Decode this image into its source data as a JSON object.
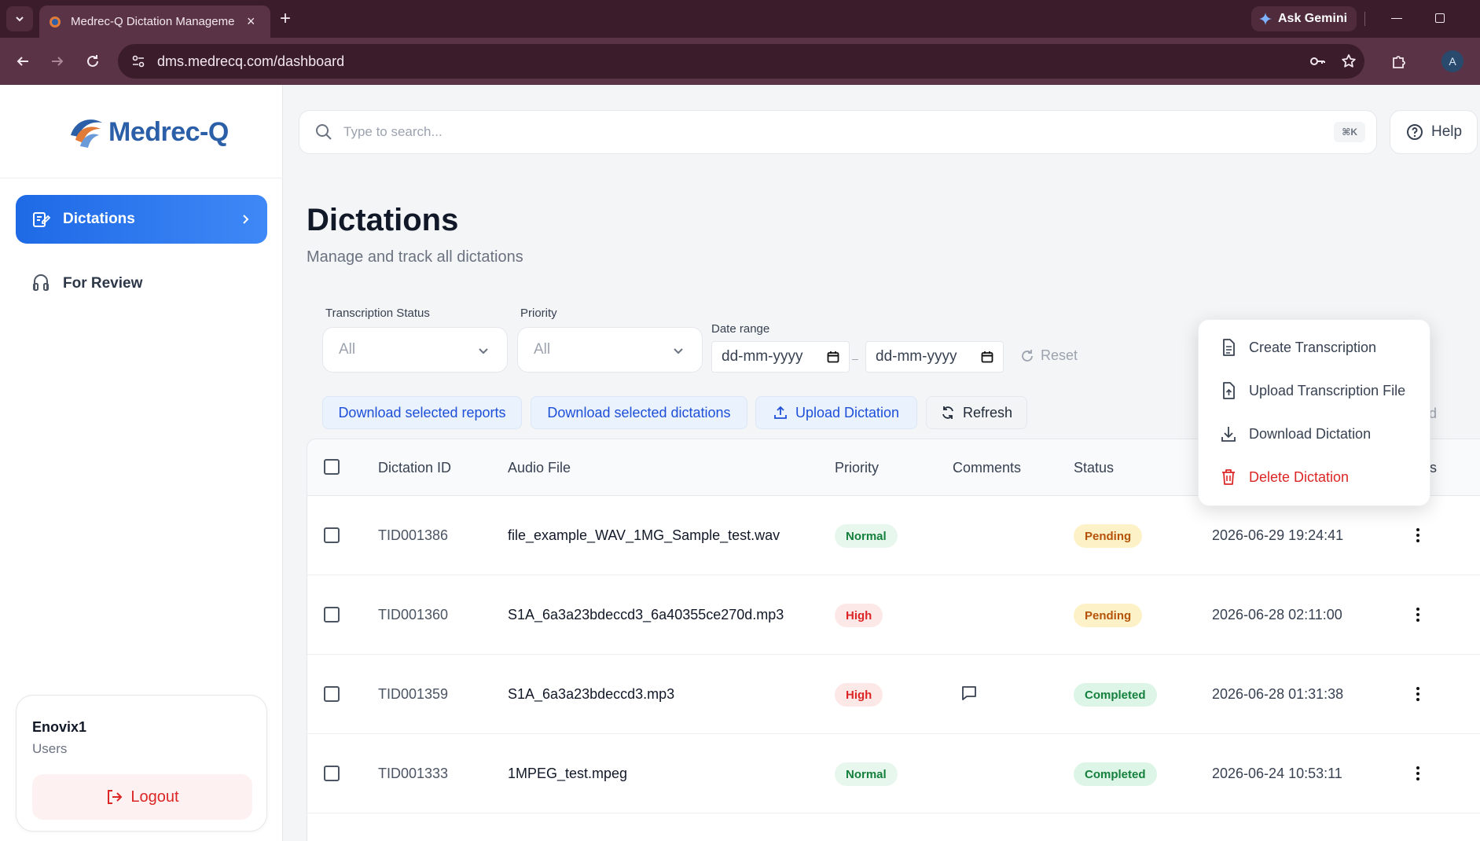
{
  "browser": {
    "tab_title": "Medrec-Q Dictation Manageme",
    "url": "dms.medrecq.com/dashboard",
    "gemini_label": "Ask Gemini",
    "profile_initial": "A"
  },
  "app": {
    "logo_text": "Medrec-Q",
    "brand_color": "#2b5fa8",
    "accent_color": "#1e6ae6"
  },
  "sidebar": {
    "items": [
      {
        "label": "Dictations",
        "icon": "edit-document-icon",
        "active": true
      },
      {
        "label": "For Review",
        "icon": "review-headset-icon",
        "active": false
      }
    ],
    "user": {
      "name": "Enovix1",
      "role": "Users",
      "logout_label": "Logout"
    }
  },
  "search": {
    "placeholder": "Type to search...",
    "shortcut": "⌘K"
  },
  "help_label": "Help",
  "page": {
    "title": "Dictations",
    "subtitle": "Manage and track all dictations"
  },
  "filters": {
    "status_label": "Transcription Status",
    "status_value": "All",
    "priority_label": "Priority",
    "priority_value": "All",
    "date_label": "Date range",
    "date_from": "dd-mm-yyyy",
    "date_to": "dd-mm-yyyy",
    "date_sep": "–",
    "reset_label": "Reset"
  },
  "actions": {
    "download_reports": "Download selected reports",
    "download_dictations": "Download selected dictations",
    "upload_dictation": "Upload Dictation",
    "refresh": "Refresh",
    "partial_hidden": "d"
  },
  "table": {
    "columns": [
      "Dictation ID",
      "Audio File",
      "Priority",
      "Comments",
      "Status",
      "s"
    ],
    "rows": [
      {
        "id": "TID001386",
        "file": "file_example_WAV_1MG_Sample_test.wav",
        "priority": "Normal",
        "has_comment": false,
        "status": "Pending",
        "timestamp": "2026-06-29 19:24:41"
      },
      {
        "id": "TID001360",
        "file": "S1A_6a3a23bdeccd3_6a40355ce270d.mp3",
        "priority": "High",
        "has_comment": false,
        "status": "Pending",
        "timestamp": "2026-06-28 02:11:00"
      },
      {
        "id": "TID001359",
        "file": "S1A_6a3a23bdeccd3.mp3",
        "priority": "High",
        "has_comment": true,
        "status": "Completed",
        "timestamp": "2026-06-28 01:31:38"
      },
      {
        "id": "TID001333",
        "file": "1MPEG_test.mpeg",
        "priority": "Normal",
        "has_comment": false,
        "status": "Completed",
        "timestamp": "2026-06-24 10:53:11"
      }
    ]
  },
  "context_menu": {
    "items": [
      {
        "label": "Create Transcription",
        "icon": "document-icon"
      },
      {
        "label": "Upload Transcription File",
        "icon": "file-upload-icon"
      },
      {
        "label": "Download Dictation",
        "icon": "download-icon"
      },
      {
        "label": "Delete Dictation",
        "icon": "trash-icon"
      }
    ]
  }
}
